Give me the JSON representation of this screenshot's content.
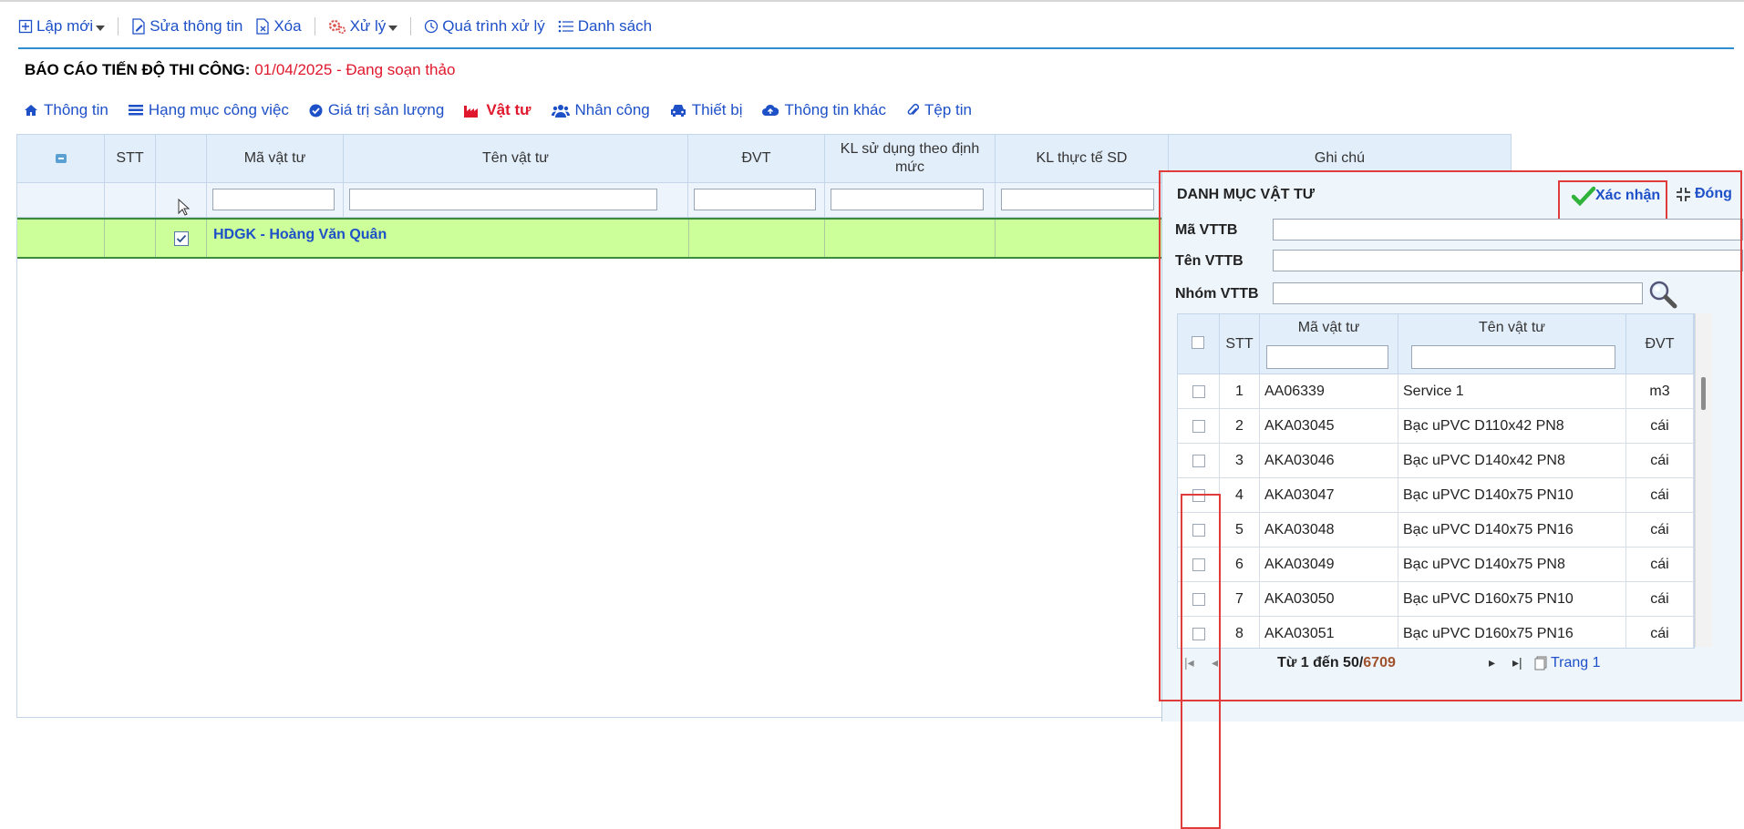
{
  "toolbar": {
    "new_label": "Lập mới",
    "edit_label": "Sửa thông tin",
    "delete_label": "Xóa",
    "process_label": "Xử lý",
    "history_label": "Quá trình xử lý",
    "list_label": "Danh sách"
  },
  "title": {
    "prefix": "BÁO CÁO TIẾN ĐỘ THI CÔNG:",
    "status": "01/04/2025 - Đang soạn thảo"
  },
  "tabs": [
    {
      "label": "Thông tin",
      "icon": "home-icon"
    },
    {
      "label": "Hạng mục công việc",
      "icon": "list-icon"
    },
    {
      "label": "Giá trị sản lượng",
      "icon": "check-circle-icon"
    },
    {
      "label": "Vật tư",
      "icon": "factory-icon",
      "active": true
    },
    {
      "label": "Nhân công",
      "icon": "users-icon"
    },
    {
      "label": "Thiết bị",
      "icon": "car-icon"
    },
    {
      "label": "Thông tin khác",
      "icon": "cloud-upload-icon"
    },
    {
      "label": "Tệp tin",
      "icon": "paperclip-icon"
    }
  ],
  "grid": {
    "columns": [
      "STT",
      "Mã vật tư",
      "Tên vật tư",
      "ĐVT",
      "KL sử dụng theo định mức",
      "KL thực tế SD",
      "Ghi chú"
    ],
    "group_row": "HDGK - Hoàng Văn Quân"
  },
  "popup": {
    "title": "DANH MỤC VẬT TƯ",
    "confirm_label": "Xác nhận",
    "close_label": "Đóng",
    "filters": {
      "code_label": "Mã VTTB",
      "name_label": "Tên VTTB",
      "group_label": "Nhóm VTTB"
    },
    "columns": [
      "STT",
      "Mã vật tư",
      "Tên vật tư",
      "ĐVT"
    ],
    "rows": [
      {
        "stt": "1",
        "code": "AA06339",
        "name": "Service 1",
        "unit": "m3"
      },
      {
        "stt": "2",
        "code": "AKA03045",
        "name": "Bạc uPVC D110x42 PN8",
        "unit": "cái"
      },
      {
        "stt": "3",
        "code": "AKA03046",
        "name": "Bạc uPVC D140x42 PN8",
        "unit": "cái"
      },
      {
        "stt": "4",
        "code": "AKA03047",
        "name": "Bạc uPVC D140x75 PN10",
        "unit": "cái"
      },
      {
        "stt": "5",
        "code": "AKA03048",
        "name": "Bạc uPVC D140x75 PN16",
        "unit": "cái"
      },
      {
        "stt": "6",
        "code": "AKA03049",
        "name": "Bạc uPVC D140x75 PN8",
        "unit": "cái"
      },
      {
        "stt": "7",
        "code": "AKA03050",
        "name": "Bạc uPVC D160x75 PN10",
        "unit": "cái"
      },
      {
        "stt": "8",
        "code": "AKA03051",
        "name": "Bạc uPVC D160x75 PN16",
        "unit": "cái"
      }
    ],
    "pager": {
      "range_text": "Từ 1 đến 50/",
      "total": "6709",
      "page_label": "Trang 1"
    }
  }
}
